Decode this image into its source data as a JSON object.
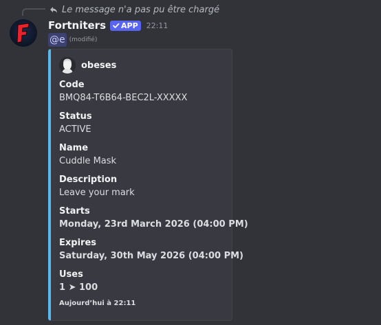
{
  "reply": {
    "text": "Le message n'a pas pu être chargé",
    "icon": "reply-arrow-icon"
  },
  "message": {
    "username": "Fortniters",
    "badge": "APP",
    "badge_icon": "checkmark-icon",
    "timestamp": "22:11",
    "mention": "@e",
    "edited": "(modifié)",
    "avatar_letter": "F"
  },
  "embed": {
    "accent_color": "#5ab9ec",
    "author": "obeses",
    "fields": [
      {
        "name": "Code",
        "value": "BMQ84-T6B64-BEC2L-XXXXX",
        "bold": false
      },
      {
        "name": "Status",
        "value": "ACTIVE",
        "bold": false
      },
      {
        "name": "Name",
        "value": "Cuddle Mask",
        "bold": false
      },
      {
        "name": "Description",
        "value": "Leave your mark",
        "bold": false
      },
      {
        "name": "Starts",
        "value": "Monday, 23rd March 2026 (04:00 PM)",
        "bold": true
      },
      {
        "name": "Expires",
        "value": "Saturday, 30th May 2026 (04:00 PM)",
        "bold": true
      },
      {
        "name": "Uses",
        "value": "1 ➤ 100",
        "bold": true
      }
    ],
    "footer": "Aujourd’hui à 22:11"
  },
  "colors": {
    "background": "#323339",
    "embed_background": "#393a41",
    "badge": "#5865f2",
    "avatar_letter": "#e8232e"
  }
}
